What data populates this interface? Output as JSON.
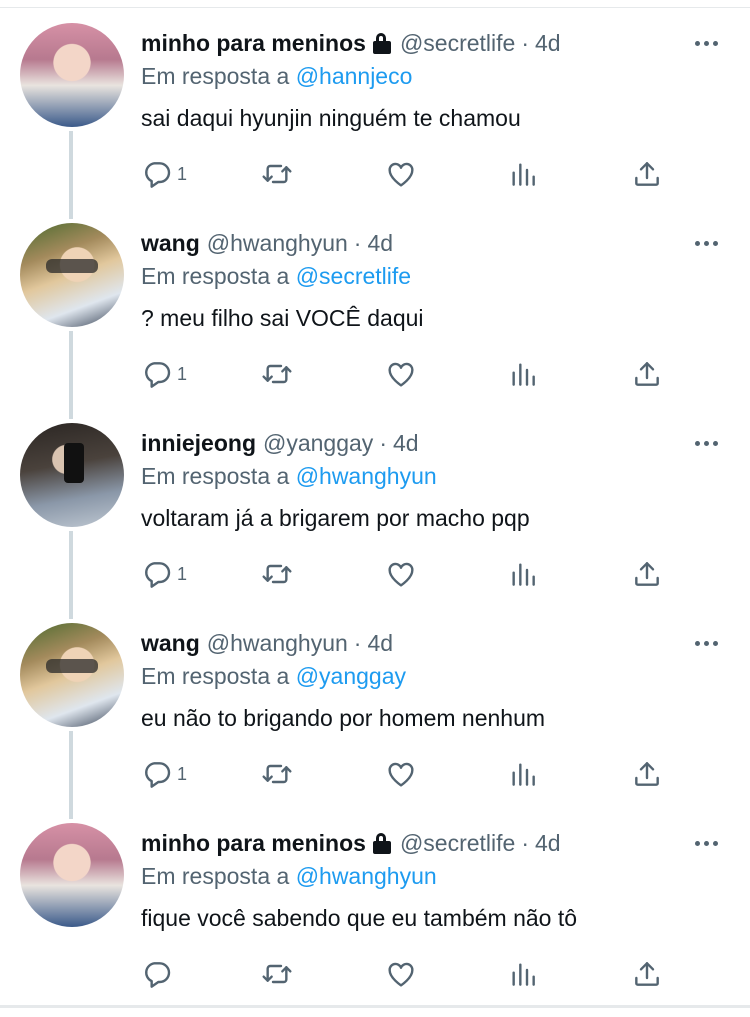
{
  "tweets": [
    {
      "name": "minho para meninos",
      "locked": true,
      "handle": "@secretlife",
      "separator": "·",
      "time": "4d",
      "reply_prefix": "Em resposta a",
      "reply_to": "@hannjeco",
      "text": "sai daqui hyunjin ninguém te chamou",
      "reply_count": "1",
      "avatar_icon": "avatar-pink-hair"
    },
    {
      "name": "wang",
      "locked": false,
      "handle": "@hwanghyun",
      "separator": "·",
      "time": "4d",
      "reply_prefix": "Em resposta a",
      "reply_to": "@secretlife",
      "text": "? meu filho sai VOCÊ daqui",
      "reply_count": "1",
      "avatar_icon": "avatar-blond-sunglasses"
    },
    {
      "name": "inniejeong",
      "locked": false,
      "handle": "@yanggay",
      "separator": "·",
      "time": "4d",
      "reply_prefix": "Em resposta a",
      "reply_to": "@hwanghyun",
      "text": "voltaram já a brigarem por macho pqp",
      "reply_count": "1",
      "avatar_icon": "avatar-mirror-selfie"
    },
    {
      "name": "wang",
      "locked": false,
      "handle": "@hwanghyun",
      "separator": "·",
      "time": "4d",
      "reply_prefix": "Em resposta a",
      "reply_to": "@yanggay",
      "text": "eu não to brigando por homem nenhum",
      "reply_count": "1",
      "avatar_icon": "avatar-blond-sunglasses"
    },
    {
      "name": "minho para meninos",
      "locked": true,
      "handle": "@secretlife",
      "separator": "·",
      "time": "4d",
      "reply_prefix": "Em resposta a",
      "reply_to": "@hwanghyun",
      "text": "fique você sabendo que eu também não tô",
      "reply_count": "",
      "avatar_icon": "avatar-pink-hair"
    }
  ],
  "colors": {
    "text": "#0f1419",
    "secondary": "#536471",
    "link": "#1d9bf0",
    "thread_line": "#cfd9de"
  }
}
